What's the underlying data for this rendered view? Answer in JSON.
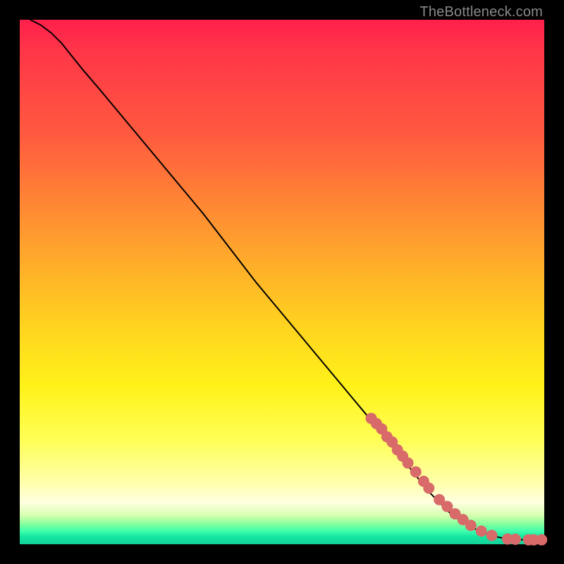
{
  "watermark": "TheBottleneck.com",
  "chart_data": {
    "type": "line",
    "title": "",
    "xlabel": "",
    "ylabel": "",
    "xlim": [
      0,
      100
    ],
    "ylim": [
      0,
      100
    ],
    "grid": false,
    "series": [
      {
        "name": "curve",
        "x": [
          2,
          4,
          6,
          8,
          10,
          12,
          15,
          20,
          25,
          30,
          35,
          40,
          45,
          50,
          55,
          60,
          65,
          70,
          72,
          74,
          76,
          78,
          80,
          82,
          84,
          86,
          88,
          90,
          91,
          92,
          93,
          94,
          96,
          98,
          100
        ],
        "y": [
          100,
          99,
          97.5,
          95.5,
          93,
          90.5,
          87,
          81,
          75,
          69,
          63,
          56.5,
          50,
          44,
          38,
          32,
          26,
          20,
          17.5,
          15,
          12.5,
          10,
          8,
          6,
          4.5,
          3.3,
          2.4,
          1.7,
          1.4,
          1.2,
          1.05,
          0.95,
          0.85,
          0.8,
          0.8
        ]
      }
    ],
    "markers": {
      "name": "dots",
      "x": [
        67,
        68,
        69,
        70,
        71,
        72,
        73,
        74,
        75.5,
        77,
        78,
        80,
        81.5,
        83,
        84.5,
        86,
        88,
        90,
        93,
        94.5,
        97,
        98,
        99.5
      ],
      "y": [
        24,
        23,
        22,
        20.5,
        19.5,
        18,
        16.8,
        15.5,
        13.8,
        12,
        10.7,
        8.5,
        7.2,
        5.8,
        4.7,
        3.6,
        2.5,
        1.7,
        1.0,
        0.95,
        0.85,
        0.85,
        0.85
      ]
    }
  }
}
